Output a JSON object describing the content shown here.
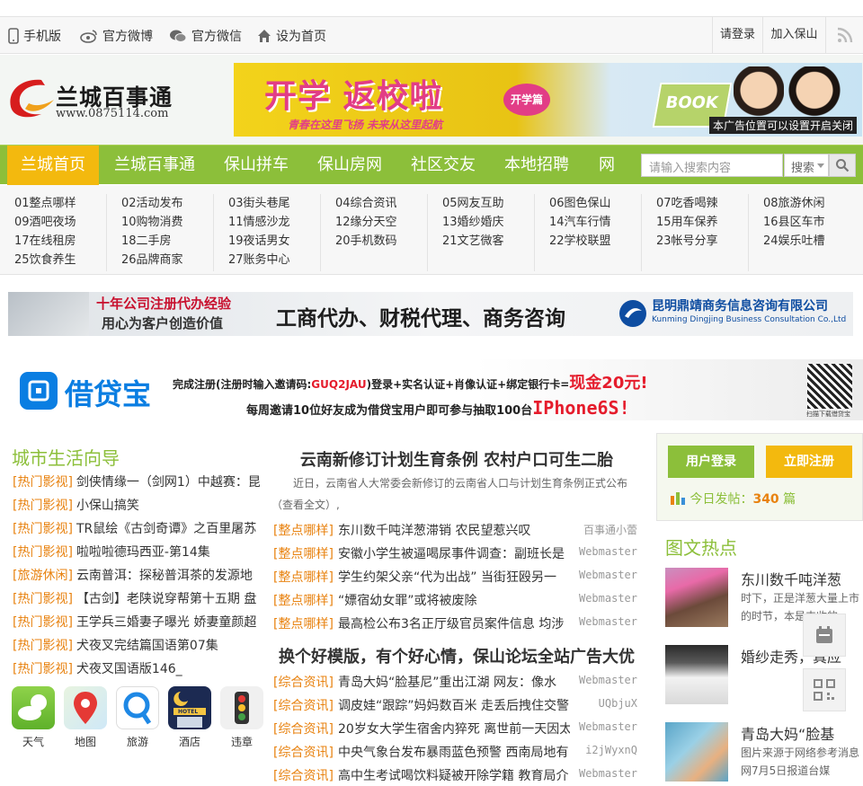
{
  "topbar": {
    "mobile": "手机版",
    "weibo": "官方微博",
    "weixin": "官方微信",
    "homepage": "设为首页",
    "login": "请登录",
    "join": "加入保山"
  },
  "header": {
    "logo_text": "兰城百事通",
    "logo_url": "www.0875114.com",
    "ad_title": "开学 返校啦",
    "ad_badge": "开学篇",
    "ad_slogan": "青春在这里飞扬 未来从这里起航",
    "ad_book": "BOOK",
    "ad_note": "本广告位置可以设置开启关闭"
  },
  "nav": {
    "items": [
      "兰城首页",
      "兰城百事通",
      "保山拼车",
      "保山房网",
      "社区交友",
      "本地招聘",
      "网"
    ],
    "search_placeholder": "请输入搜索内容",
    "search_select": "搜索"
  },
  "categories": [
    "01整点哪样",
    "02活动发布",
    "03街头巷尾",
    "04综合资讯",
    "05网友互助",
    "06图色保山",
    "07吃香喝辣",
    "08旅游休闲",
    "09酒吧夜场",
    "10购物消费",
    "11情感沙龙",
    "12缘分天空",
    "13婚纱婚庆",
    "14汽车行情",
    "15用车保养",
    "16县区车市",
    "17在线租房",
    "18二手房",
    "19夜话男女",
    "20手机数码",
    "21文艺微客",
    "22学校联盟",
    "23帐号分享",
    "24娱乐吐槽",
    "25饮食养生",
    "26品牌商家",
    "27账务中心"
  ],
  "banner2": {
    "line1": "十年公司注册代办经验",
    "line2": "用心为客户创造价值",
    "main": "工商代办、财税代理、商务咨询",
    "company": "昆明鼎靖商务信息咨询有限公司",
    "company_en": "Kunming Dingjing Business Consultation Co.,Ltd"
  },
  "banner3": {
    "name": "借贷宝",
    "line1_a": "完成注册(注册时输入邀请码:",
    "line1_code": "GUQ2JAU",
    "line1_b": ")登录+实名认证+肖像认证+绑定银行卡=",
    "line1_cash": "现金20元!",
    "line2_a": "每周邀请10位好友成为借贷宝用户即可参与抽取100台",
    "line2_prize": "IPhone6S!",
    "qr_caption": "扫描下载借贷宝"
  },
  "left": {
    "title": "城市生活向导",
    "items": [
      {
        "tag": "[热门影视]",
        "text": "剑侠情缘一（剑网1）中越赛：昆"
      },
      {
        "tag": "[热门影视]",
        "text": "小保山搞笑"
      },
      {
        "tag": "[热门影视]",
        "text": "TR鼠绘《古剑奇谭》之百里屠苏"
      },
      {
        "tag": "[热门影视]",
        "text": "啦啦啦德玛西亚-第14集"
      },
      {
        "tag": "[旅游休闲]",
        "text": "云南普洱：探秘普洱茶的发源地"
      },
      {
        "tag": "[热门影视]",
        "text": "【古剑】老陕说穿帮第十五期 盘"
      },
      {
        "tag": "[热门影视]",
        "text": "王学兵三婚妻子曝光 娇妻童颜超"
      },
      {
        "tag": "[热门影视]",
        "text": "犬夜叉完结篇国语第07集"
      },
      {
        "tag": "[热门影视]",
        "text": "犬夜叉国语版146_"
      }
    ],
    "apps": [
      "天气",
      "地图",
      "旅游",
      "酒店",
      "违章"
    ],
    "hotel_sign": "HOTEL"
  },
  "mid": {
    "headline": "云南新修订计划生育条例 农村户口可生二胎",
    "summary": "近日，云南省人大常委会新修订的云南省人口与计划生育条例正式公布（查看全文）,",
    "list1": [
      {
        "tag": "[整点哪样]",
        "title": "东川数千吨洋葱滞销 农民望惹兴叹",
        "author": "百事通小蕾"
      },
      {
        "tag": "[整点哪样]",
        "title": "安徽小学生被逼喝尿事件调查：副班长是",
        "author": "Webmaster"
      },
      {
        "tag": "[整点哪样]",
        "title": "学生约架父亲“代为出战” 当街狂殴另一",
        "author": "Webmaster"
      },
      {
        "tag": "[整点哪样]",
        "title": "“嫖宿幼女罪”或将被废除",
        "author": "Webmaster"
      },
      {
        "tag": "[整点哪样]",
        "title": "最高检公布3名正厅级官员案件信息 均涉",
        "author": "Webmaster"
      }
    ],
    "headline2": "换个好模版，有个好心情，保山论坛全站广告大优",
    "list2": [
      {
        "tag": "[综合资讯]",
        "title": "青岛大妈“脸基尼”重出江湖 网友：像水",
        "author": "Webmaster"
      },
      {
        "tag": "[综合资讯]",
        "title": "调皮娃“跟踪”妈妈数百米 走丢后拽住交警",
        "author": "UQbjuX"
      },
      {
        "tag": "[综合资讯]",
        "title": "20岁女大学生宿舍内猝死 离世前一天因太",
        "author": "Webmaster"
      },
      {
        "tag": "[综合资讯]",
        "title": "中央气象台发布暴雨蓝色预警 西南局地有",
        "author": "i2jWyxnQ"
      },
      {
        "tag": "[综合资讯]",
        "title": "高中生考试喝饮料疑被开除学籍 教育局介",
        "author": "Webmaster"
      }
    ]
  },
  "right": {
    "login_btn": "用户登录",
    "register_btn": "立即注册",
    "today_label": "今日发帖：",
    "today_count": "340",
    "today_unit": " 篇",
    "hot_title": "图文热点",
    "hot": [
      {
        "title": "东川数千吨洋葱",
        "desc": "时下，正是洋葱大量上市的时节，本是丰收的"
      },
      {
        "title": "婚纱走秀，真应",
        "desc": ""
      },
      {
        "title": "青岛大妈“脸基",
        "desc": "图片来源于网络参考消息网7月5日报道台媒"
      }
    ]
  },
  "colors": {
    "green": "#8cbf3a",
    "orange": "#f3b90e",
    "tag": "#e8820f"
  }
}
